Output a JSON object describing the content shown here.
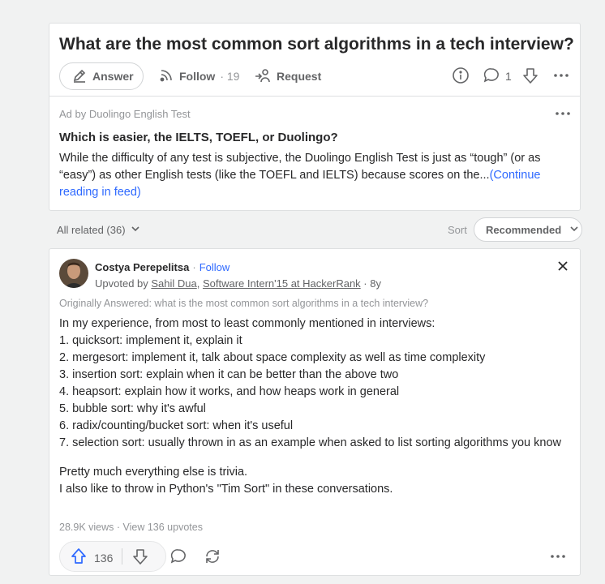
{
  "question": {
    "title": "What are the most common sort algorithms in a tech interview?",
    "answer_label": "Answer",
    "follow_label": "Follow",
    "follow_count": "· 19",
    "request_label": "Request",
    "comment_count": "1"
  },
  "ad": {
    "label": "Ad by Duolingo English Test",
    "title": "Which is easier, the IELTS, TOEFL, or Duolingo?",
    "body": "While the difficulty of any test is subjective, the Duolingo English Test is just as “tough” (or as “easy”) as other English tests (like the TOEFL and IELTS) because scores on the...",
    "continue": "(Continue reading in feed)"
  },
  "related": {
    "label": "All related (36)",
    "sort_label": "Sort",
    "sort_value": "Recommended"
  },
  "answer": {
    "author": "Costya Perepelitsa",
    "dot": "·",
    "follow": "Follow",
    "upvoted_prefix": "Upvoted by ",
    "upvoter": "Sahil Dua",
    "upvoter_sep": ", ",
    "upvoter_credential": "Software Intern'15 at HackerRank",
    "age": " · 8y",
    "originally": "Originally Answered: what is the most common sort algorithms in a tech interview?",
    "intro": "In my experience, from most to least commonly mentioned in interviews:",
    "items": [
      "1. quicksort: implement it, explain it",
      "2. mergesort: implement it, talk about space complexity as well as time complexity",
      "3. insertion sort: explain when it can be better than the above two",
      "4. heapsort: explain how it works, and how heaps work in general",
      "5. bubble sort: why it's awful",
      "6. radix/counting/bucket sort: when it's useful",
      "7. selection sort: usually thrown in as an example when asked to list sorting algorithms you know"
    ],
    "outro_1": "Pretty much everything else is trivia.",
    "outro_2": "I also like to throw in Python's \"Tim Sort\" in these conversations.",
    "views": "28.9K views",
    "stats_sep": " · ",
    "view_upvotes": "View 136 upvotes",
    "upvotes": "136"
  },
  "colors": {
    "accent": "#2e69ff",
    "text": "#282829",
    "muted": "#939598",
    "border": "#dee0e1"
  }
}
